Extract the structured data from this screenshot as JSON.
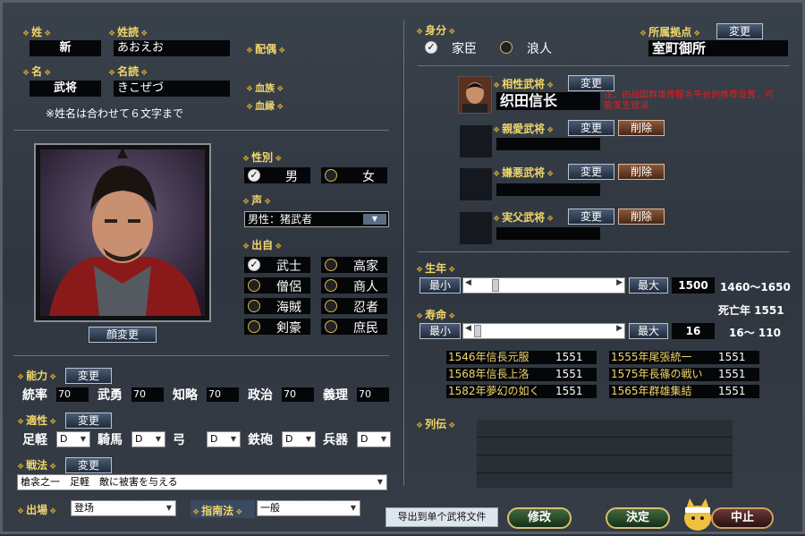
{
  "left": {
    "surname": {
      "label": "姓",
      "value": "新"
    },
    "surname_reading": {
      "label": "姓読",
      "value": "あおえお"
    },
    "given": {
      "label": "名",
      "value": "武将"
    },
    "given_reading": {
      "label": "名読",
      "value": "きこぜづ"
    },
    "spouse_label": "配偶",
    "clan_label": "血族",
    "blood_label": "血縁",
    "note": "※姓名は合わせて６文字まで",
    "face_button": "顔変更",
    "gender": {
      "label": "性別",
      "male": "男",
      "female": "女"
    },
    "voice": {
      "label": "声",
      "value": "男性：猪武者"
    },
    "origin": {
      "label": "出自",
      "options": [
        "武士",
        "高家",
        "僧侶",
        "商人",
        "海賊",
        "忍者",
        "剣豪",
        "庶民"
      ]
    },
    "abilities": {
      "label": "能力",
      "change": "変更",
      "items": [
        {
          "name": "統率",
          "value": "70"
        },
        {
          "name": "武勇",
          "value": "70"
        },
        {
          "name": "知略",
          "value": "70"
        },
        {
          "name": "政治",
          "value": "70"
        },
        {
          "name": "義理",
          "value": "70"
        }
      ]
    },
    "aptitude": {
      "label": "適性",
      "change": "変更",
      "items": [
        {
          "name": "足軽",
          "value": "D"
        },
        {
          "name": "騎馬",
          "value": "D"
        },
        {
          "name": "弓",
          "value": "D"
        },
        {
          "name": "鉄砲",
          "value": "D"
        },
        {
          "name": "兵器",
          "value": "D"
        }
      ]
    },
    "tactics": {
      "label": "戦法",
      "change": "変更",
      "value": "槍衾之一　足軽　敵に被害を与える"
    },
    "appear": {
      "label": "出場",
      "value": "登场"
    },
    "guide": {
      "label": "指南法",
      "value": "一般"
    }
  },
  "right": {
    "status": {
      "label": "身分",
      "vassal": "家臣",
      "ronin": "浪人"
    },
    "base": {
      "label": "所属拠点",
      "change": "変更",
      "value": "室町御所"
    },
    "compat": {
      "label": "相性武将",
      "change": "変更",
      "value": "织田信长",
      "warning": "注：由战国群雄传服务平台的推荐设置，可能发生错误"
    },
    "love": {
      "label": "親愛武将",
      "change": "変更",
      "del": "削除"
    },
    "hate": {
      "label": "嫌悪武将",
      "change": "変更",
      "del": "削除"
    },
    "father": {
      "label": "実父武将",
      "change": "変更",
      "del": "削除"
    },
    "birth": {
      "label": "生年",
      "min": "最小",
      "max": "最大",
      "value": "1500",
      "range": "1460～1650"
    },
    "death_year": "死亡年 1551",
    "life": {
      "label": "寿命",
      "min": "最小",
      "max": "最大",
      "value": "16",
      "range": "16～ 110"
    },
    "events": [
      {
        "name": "1546年信長元服",
        "year": "1551"
      },
      {
        "name": "1555年尾張統一",
        "year": "1551"
      },
      {
        "name": "1568年信長上洛",
        "year": "1551"
      },
      {
        "name": "1575年長篠の戦い",
        "year": "1551"
      },
      {
        "name": "1582年夢幻の如く",
        "year": "1551"
      },
      {
        "name": "1565年群雄集結",
        "year": "1551"
      }
    ],
    "bio_label": "列伝"
  },
  "bottom": {
    "export": "导出到单个武将文件",
    "modify": "修改",
    "ok": "決定",
    "cancel": "中止"
  }
}
